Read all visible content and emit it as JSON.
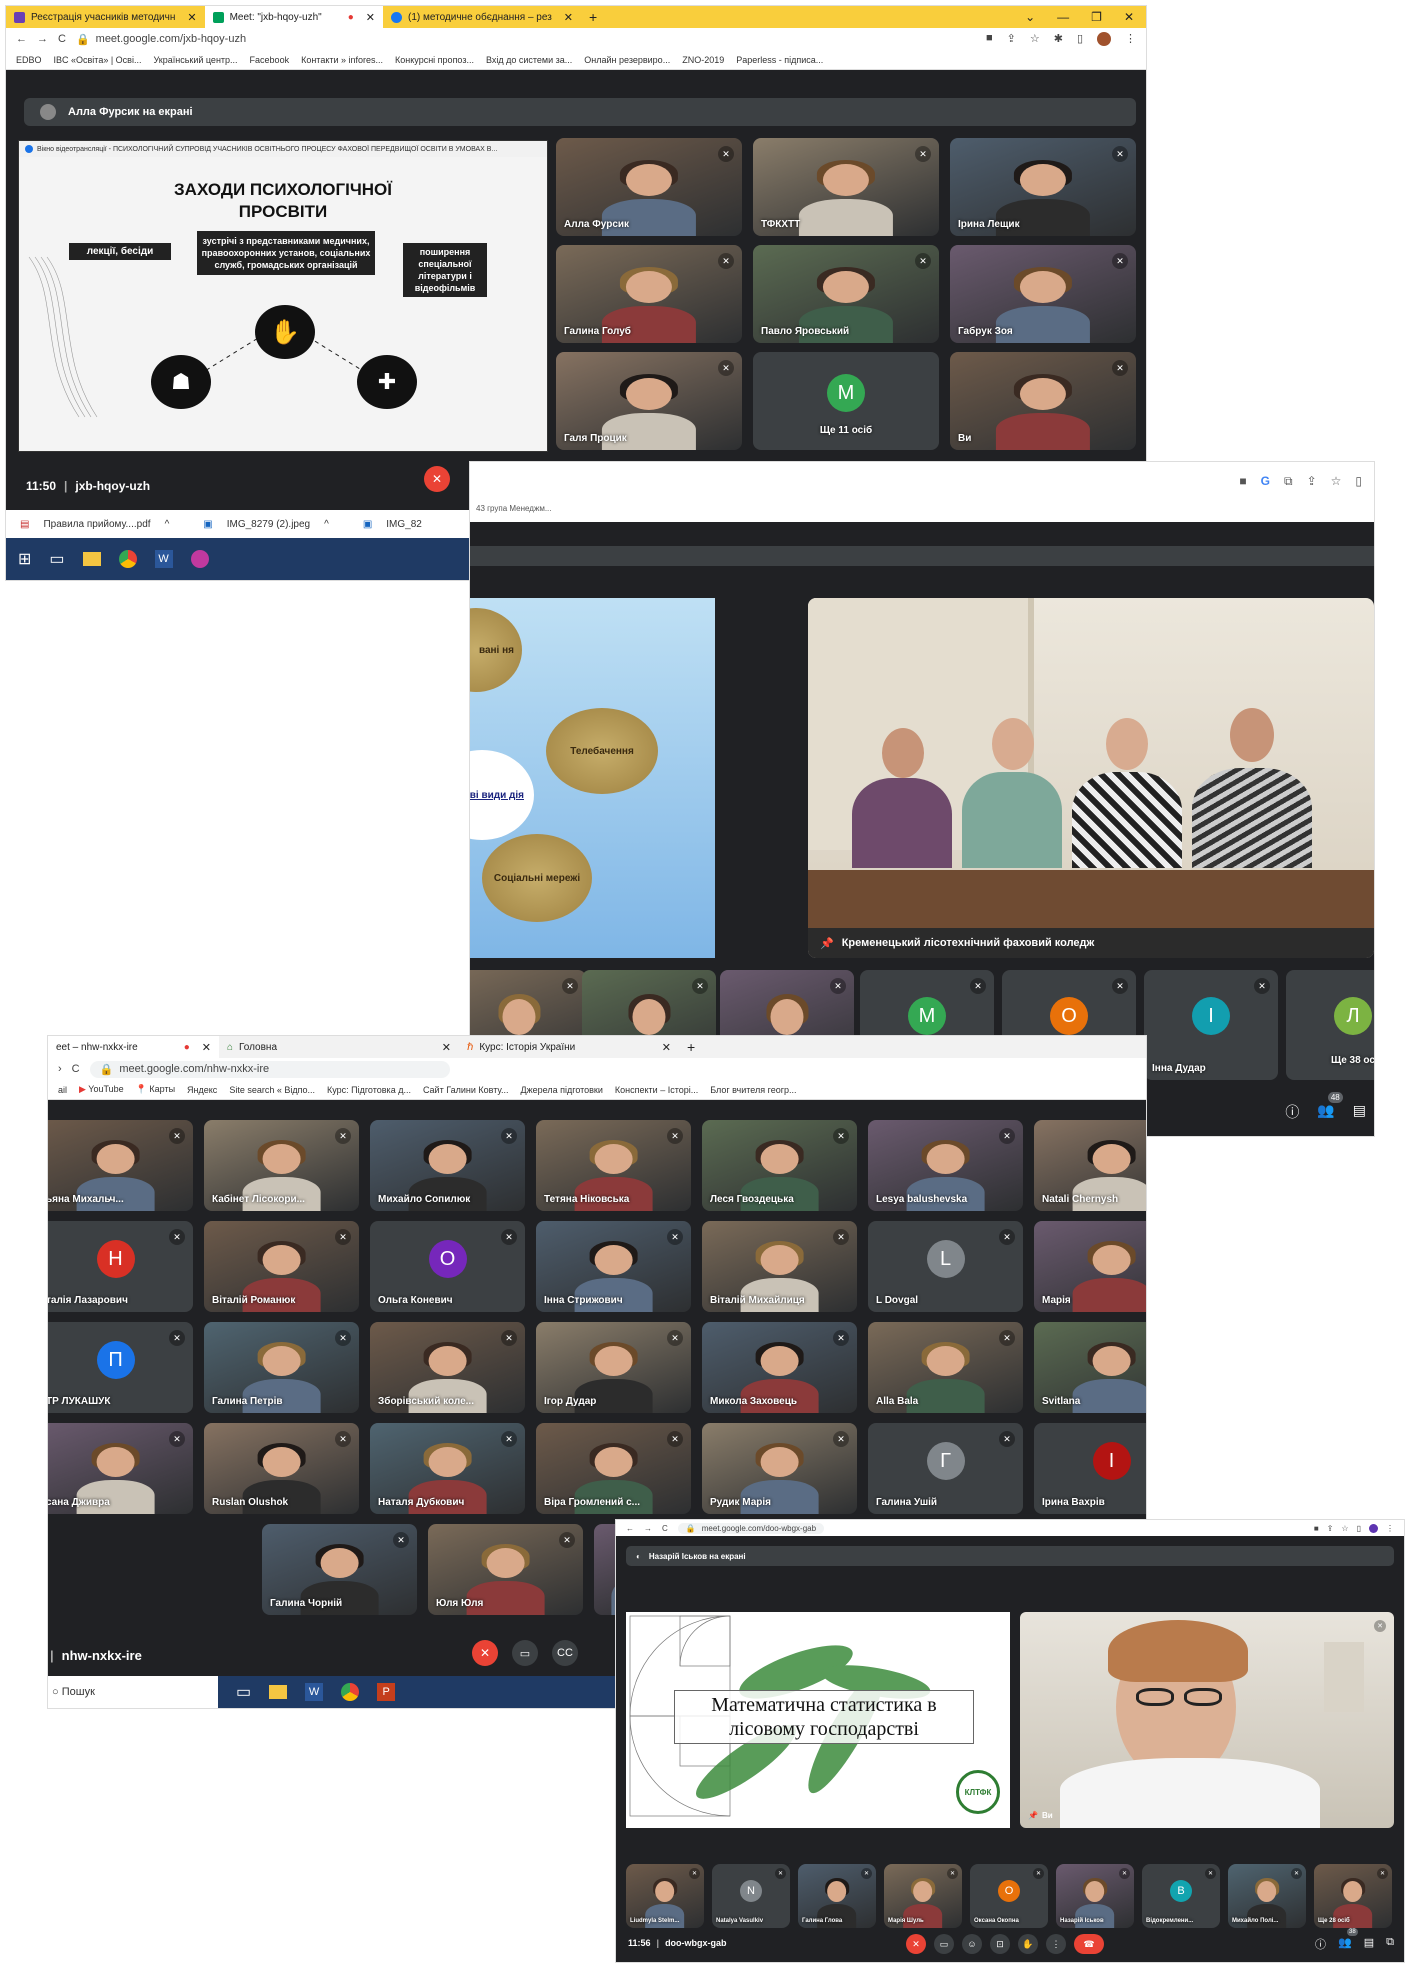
{
  "s1": {
    "tabs": [
      {
        "label": "Реєстрація учасників методичн"
      },
      {
        "label": "Meet: \"jxb-hqoy-uzh\""
      },
      {
        "label": "(1) методичне обєднання – рез"
      }
    ],
    "url": "meet.google.com/jxb-hqoy-uzh",
    "bookmarks": [
      "EDBO",
      "IBC «Освіта» | Осві...",
      "Український центр...",
      "Facebook",
      "Контакти » infores...",
      "Конкурсні пропоз...",
      "Вхід до системи за...",
      "Онлайн резервиро...",
      "ZNO-2019",
      "Paperless - підписа..."
    ],
    "presenter": "Алла Фурсик на екрані",
    "window_title": "Вікно відеотрансляції - ПСИХОЛОГІЧНИЙ СУПРОВІД УЧАСНИКІВ ОСВІТНЬОГО ПРОЦЕСУ ФАХОВОЇ ПЕРЕДВИЩОЇ ОСВІТИ В УМОВАХ В...",
    "slide": {
      "title_1": "ЗАХОДИ ПСИХОЛОГІЧНОЇ",
      "title_2": "ПРОСВІТИ",
      "box_left": "лекції, бесіди",
      "box_center": "зустрічі з представниками медичних, правоохоронних установ, соціальних служб, громадських організацій",
      "box_right": "поширення спеціальної літератури і відеофільмів"
    },
    "participants": [
      {
        "name": "Алла Фурсик"
      },
      {
        "name": "ТФКХТТ"
      },
      {
        "name": "Ірина Лещик"
      },
      {
        "name": "Галина Голуб"
      },
      {
        "name": "Павло Яровський"
      },
      {
        "name": "Габрук Зоя"
      },
      {
        "name": "Галя Процик"
      },
      {
        "name": "Ще 11 осіб",
        "avatar": "M"
      },
      {
        "name": "Ви"
      }
    ],
    "time": "11:50",
    "meeting": "jxb-hqoy-uzh",
    "downloads": [
      "Правила прийому....pdf",
      "IMG_8279 (2).jpeg",
      "IMG_82"
    ]
  },
  "s2": {
    "window_label": "43 група Менеджм...",
    "bubbles": [
      "вані ня",
      "Телебачення",
      "ві види дія",
      "Соціальні мережі"
    ],
    "pinned": "Кременецький лісотехнічний фаховий коледж",
    "participants": [
      {
        "name": ""
      },
      {
        "name": ""
      },
      {
        "name": ""
      },
      {
        "name": "",
        "avatar": "M"
      },
      {
        "name": "",
        "avatar": "O"
      },
      {
        "name": "Інна Дудар",
        "avatar": "I"
      },
      {
        "name": "Ще 38 ос",
        "avatar": "Л"
      }
    ],
    "count": "48"
  },
  "s3": {
    "tabs": [
      {
        "label": "eet – nhw-nxkx-ire"
      },
      {
        "label": "Головна"
      },
      {
        "label": "Курс: Історія України"
      }
    ],
    "url": "meet.google.com/nhw-nxkx-ire",
    "bookmarks": [
      "ail",
      "YouTube",
      "Карты",
      "Яндекс",
      "Site search « Відпо...",
      "Курс: Підготовка д...",
      "Сайт Галини Ковту...",
      "Джерела підготовки",
      "Конспекти – Історі...",
      "Блог вчителя геогр..."
    ],
    "grid": [
      {
        "name": "ьяна Михальч..."
      },
      {
        "name": "Кабінет Лісокори..."
      },
      {
        "name": "Михайло Сопилюк"
      },
      {
        "name": "Тетяна Ніковська"
      },
      {
        "name": "Леся Гвоздецька"
      },
      {
        "name": "Lesya balushevska"
      },
      {
        "name": "Natali Chernysh"
      },
      {
        "name": "талія Лазарович",
        "avatar": "Н"
      },
      {
        "name": "Віталій Романюк"
      },
      {
        "name": "Ольга Коневич",
        "avatar": "О"
      },
      {
        "name": "Інна Стрижович"
      },
      {
        "name": "Віталій Михайлиця"
      },
      {
        "name": "L Dovgal",
        "avatar": "L"
      },
      {
        "name": "Марія"
      },
      {
        "name": "ТР ЛУКАШУК",
        "avatar": "П"
      },
      {
        "name": "Галина Петрів"
      },
      {
        "name": "Зборівський коле..."
      },
      {
        "name": "Ігор Дудар"
      },
      {
        "name": "Микола Заховець"
      },
      {
        "name": "Alla Bala"
      },
      {
        "name": "Svitlana"
      },
      {
        "name": "сана Дживра"
      },
      {
        "name": "Ruslan Olushok"
      },
      {
        "name": "Наталя Дубкович"
      },
      {
        "name": "Віра Громлений с..."
      },
      {
        "name": "Рудик Марія"
      },
      {
        "name": "Галина Ушій",
        "avatar": "Г"
      },
      {
        "name": "Ірина Вахрів",
        "avatar": "І"
      }
    ],
    "extra": [
      {
        "name": "Галина Чорній"
      },
      {
        "name": "Юля Юля"
      }
    ],
    "meeting": "nhw-nxkx-ire",
    "search": "Пошук"
  },
  "s4": {
    "url": "meet.google.com/doo-wbgx-gab",
    "presenter": "Назарій Іськов на екрані",
    "slide_title": "Математична статистика в лісовому господарстві",
    "logo": "КЛТФК",
    "self": "Ви",
    "strip": [
      {
        "name": "Liudmyla Stelm..."
      },
      {
        "name": "Natalya Vasulkiv",
        "avatar": "N"
      },
      {
        "name": "Галина Глова"
      },
      {
        "name": "Марія Шуль"
      },
      {
        "name": "Оксана Окопна",
        "avatar": "O"
      },
      {
        "name": "Назарій Іськов"
      },
      {
        "name": "Відокремлени...",
        "avatar": "B"
      },
      {
        "name": "Михайло Полі..."
      },
      {
        "name": "Ще 28 осіб"
      }
    ],
    "time": "11:56",
    "meeting": "doo-wbgx-gab",
    "count": "38"
  }
}
